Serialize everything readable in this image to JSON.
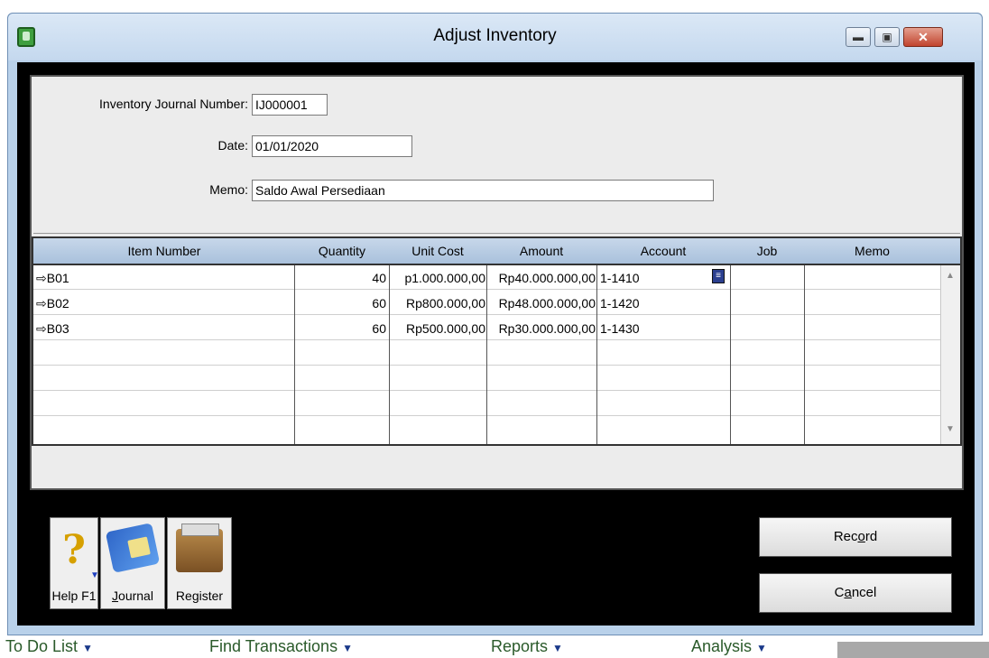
{
  "window": {
    "title": "Adjust Inventory",
    "min_glyph": "▬",
    "max_glyph": "▣",
    "close_glyph": "✕"
  },
  "form": {
    "journal_number_label": "Inventory Journal Number:",
    "journal_number_value": "IJ000001",
    "date_label": "Date:",
    "date_value": "01/01/2020",
    "memo_label": "Memo:",
    "memo_value": "Saldo Awal Persediaan"
  },
  "grid": {
    "columns": [
      "Item Number",
      "Quantity",
      "Unit Cost",
      "Amount",
      "Account",
      "Job",
      "Memo"
    ],
    "rows": [
      {
        "item": "⇨B01",
        "quantity": "40",
        "unit_cost": "p1.000.000,00",
        "amount": "Rp40.000.000,00",
        "account": "1-1410",
        "job": "",
        "memo": ""
      },
      {
        "item": "⇨B02",
        "quantity": "60",
        "unit_cost": "Rp800.000,00",
        "amount": "Rp48.000.000,00",
        "account": "1-1420",
        "job": "",
        "memo": ""
      },
      {
        "item": "⇨B03",
        "quantity": "60",
        "unit_cost": "Rp500.000,00",
        "amount": "Rp30.000.000,00",
        "account": "1-1430",
        "job": "",
        "memo": ""
      }
    ]
  },
  "toolbar": {
    "help_label": "Help F1",
    "journal_label_pre": "",
    "journal_label_u": "J",
    "journal_label_post": "ournal",
    "register_label_pre": "Re",
    "register_label_u": "g",
    "register_label_post": "ister"
  },
  "buttons": {
    "record_pre": "Rec",
    "record_u": "o",
    "record_post": "rd",
    "cancel_pre": "C",
    "cancel_u": "a",
    "cancel_post": "ncel"
  },
  "background_strip": {
    "todo": "To Do List",
    "find": "Find Transactions",
    "reports": "Reports",
    "analysis": "Analysis"
  }
}
